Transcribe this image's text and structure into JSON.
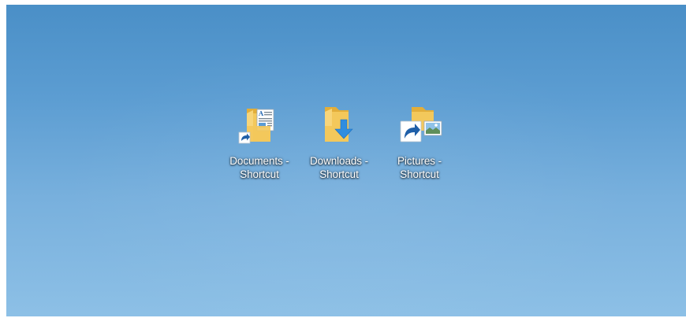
{
  "desktop": {
    "background_top": "#4a8fc7",
    "background_bottom": "#8dc0e6",
    "icons": [
      {
        "name": "documents-shortcut",
        "label": "Documents -\nShortcut",
        "icon": "documents-folder-icon",
        "shortcut_overlay": true
      },
      {
        "name": "downloads-shortcut",
        "label": "Downloads -\nShortcut",
        "icon": "downloads-folder-icon",
        "shortcut_overlay": false
      },
      {
        "name": "pictures-shortcut",
        "label": "Pictures -\nShortcut",
        "icon": "pictures-folder-icon",
        "shortcut_overlay": true
      }
    ]
  },
  "colors": {
    "folder": "#f3c85b",
    "folder_dark": "#e2ae3a",
    "download_arrow": "#2f8de0",
    "shortcut_arrow": "#1f5fa8"
  }
}
